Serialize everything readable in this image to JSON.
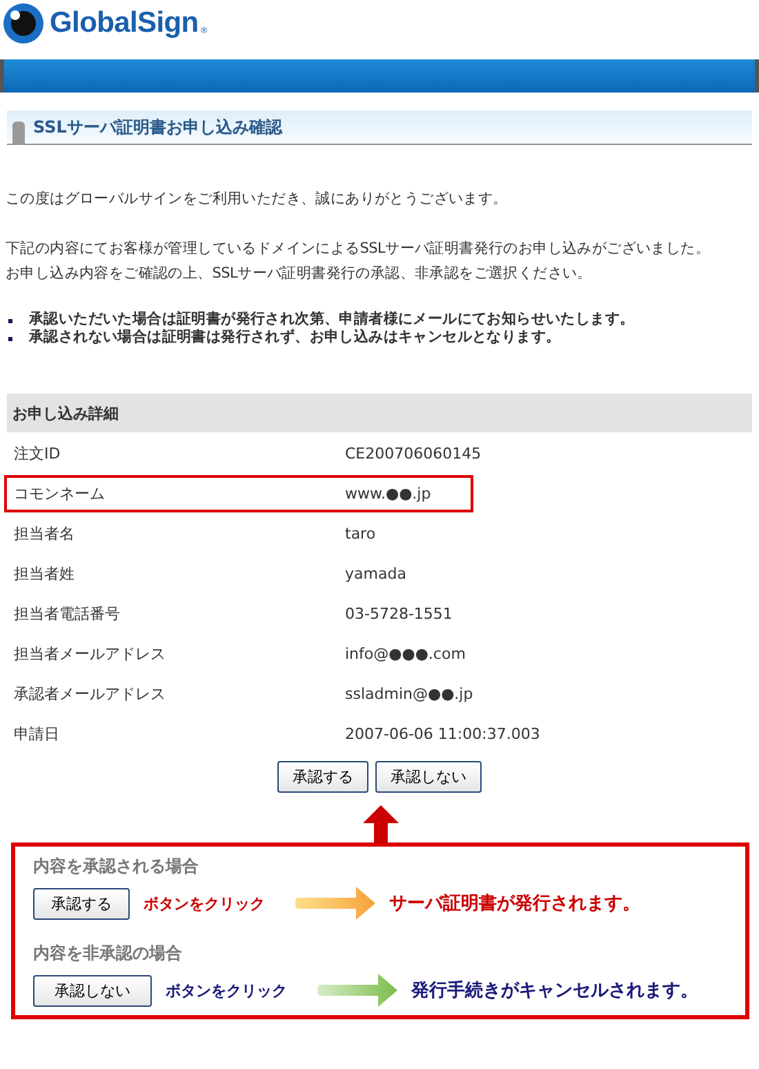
{
  "logo": {
    "text": "GlobalSign",
    "mark": "®"
  },
  "page_title": "SSLサーバ証明書お申し込み確認",
  "intro": [
    "この度はグローバルサインをご利用いただき、誠にありがとうございます。",
    "下記の内容にてお客様が管理しているドメインによるSSLサーバ証明書発行のお申し込みがございました。",
    "お申し込み内容をご確認の上、SSLサーバ証明書発行の承認、非承認をご選択ください。"
  ],
  "notes": [
    "承認いただいた場合は証明書が発行され次第、申請者様にメールにてお知らせいたします。",
    "承認されない場合は証明書は発行されず、お申し込みはキャンセルとなります。"
  ],
  "details": {
    "heading": "お申し込み詳細",
    "rows": [
      {
        "label": "注文ID",
        "value": "CE200706060145",
        "highlighted": false
      },
      {
        "label": "コモンネーム",
        "value": "www.●●.jp",
        "highlighted": true
      },
      {
        "label": "担当者名",
        "value": "taro",
        "highlighted": false
      },
      {
        "label": "担当者姓",
        "value": "yamada",
        "highlighted": false
      },
      {
        "label": "担当者電話番号",
        "value": "03-5728-1551",
        "highlighted": false
      },
      {
        "label": "担当者メールアドレス",
        "value": "info@●●●.com",
        "highlighted": false
      },
      {
        "label": "承認者メールアドレス",
        "value": "ssladmin@●●.jp",
        "highlighted": false
      },
      {
        "label": "申請日",
        "value": "2007-06-06 11:00:37.003",
        "highlighted": false
      }
    ]
  },
  "buttons": [
    "承認する",
    "承認しない"
  ],
  "guide": [
    {
      "kind": "approve",
      "heading": "内容を承認される場合",
      "button": "承認する",
      "action": "ボタンをクリック",
      "result": "サーバ証明書が発行されます。"
    },
    {
      "kind": "reject",
      "heading": "内容を非承認の場合",
      "button": "承認しない",
      "action": "ボタンをクリック",
      "result": "発行手続きがキャンセルされます。"
    }
  ]
}
